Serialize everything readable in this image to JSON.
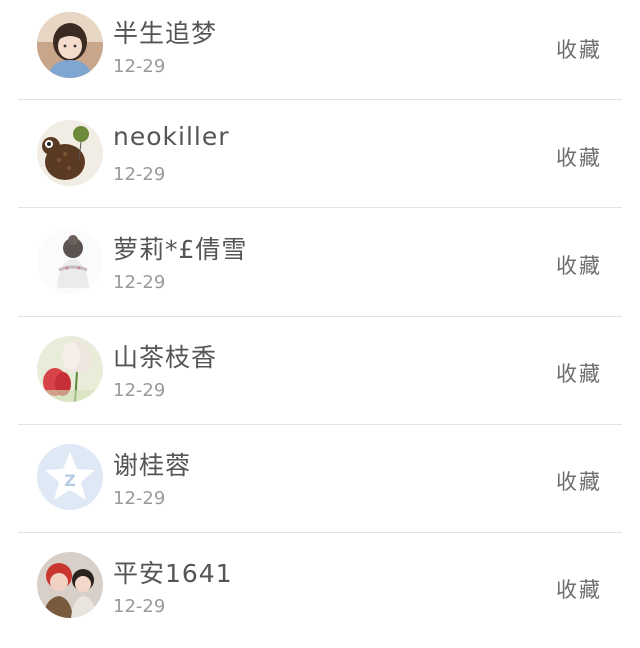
{
  "items": [
    {
      "name": "半生追梦",
      "date": "12-29",
      "action": "收藏",
      "avatar": "girl-portrait"
    },
    {
      "name": "neokiller",
      "date": "12-29",
      "action": "收藏",
      "avatar": "coffee-bear"
    },
    {
      "name": "萝莉*£倩雪",
      "date": "12-29",
      "action": "收藏",
      "avatar": "girl-back-sketch"
    },
    {
      "name": "山茶枝香",
      "date": "12-29",
      "action": "收藏",
      "avatar": "tulip-flowers"
    },
    {
      "name": "谢桂蓉",
      "date": "12-29",
      "action": "收藏",
      "avatar": "qzone-star-default"
    },
    {
      "name": "平安1641",
      "date": "12-29",
      "action": "收藏",
      "avatar": "kids-photo"
    }
  ]
}
